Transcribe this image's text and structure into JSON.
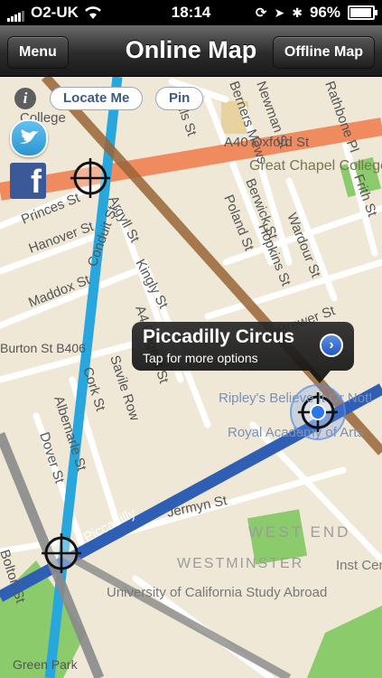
{
  "status_bar": {
    "carrier": "O2-UK",
    "time": "18:14",
    "battery": "96%",
    "battery_level": 0.96
  },
  "nav": {
    "title": "Online Map",
    "left_button": "Menu",
    "right_button": "Offline Map"
  },
  "controls": {
    "info": "i",
    "locate_me": "Locate Me",
    "pin": "Pin",
    "twitter_icon": "twitter-icon",
    "facebook_icon": "facebook-icon",
    "facebook_glyph": "f"
  },
  "callout": {
    "title": "Piccadilly Circus",
    "subtitle": "Tap for more options",
    "disclosure": "›"
  },
  "map": {
    "colors": {
      "ground": "#efe8d7",
      "street": "#ffffff",
      "oxford_st": "#f08a5f",
      "line_light_blue": "#28a7de",
      "line_brown": "#9a6536",
      "line_dark_blue": "#2f5fb5",
      "line_grey": "#8a8a8a",
      "park": "#8bcb6c"
    },
    "labels": {
      "a40_oxford_st": "A40 Oxford St",
      "great_chapel_college": "Great Chapel College",
      "princes_st": "Princes St",
      "hanover_st": "Hanover St",
      "argyll_st": "Argyll St",
      "poland_st": "Poland St",
      "berwick_st": "Berwick St",
      "hopkins_st": "Hopkins St",
      "wardour_st": "Wardour St",
      "frith_st": "Frith St",
      "maddox_st": "Maddox St",
      "conduit_st": "Conduit St",
      "kingly_st": "Kingly St",
      "a4_regent_st": "A4 Regent St",
      "brewer_st": "Brewer St",
      "savile_row": "Savile Row",
      "cork_st": "Cork St",
      "albemarle_st": "Albemarle St",
      "dover_st": "Dover St",
      "ripleys": "Ripley's Believe It Or Not!",
      "royal_academy": "Royal Academy of Arts",
      "jermyn_st": "Jermyn St",
      "piccadilly": "Piccadilly",
      "west_end": "WEST END",
      "westminster": "WESTMINSTER",
      "bolton_st": "Bolton St",
      "uni_california": "University of California Study Abroad",
      "wells_st": "Wells St",
      "newman_st": "Newman St",
      "berners_mews": "Berners Mews",
      "rathbone_pl": "Rathbone Pl",
      "college": "College",
      "burton_st": "Burton St B406",
      "inst_center": "Inst Center",
      "green_park": "Green Park"
    }
  }
}
